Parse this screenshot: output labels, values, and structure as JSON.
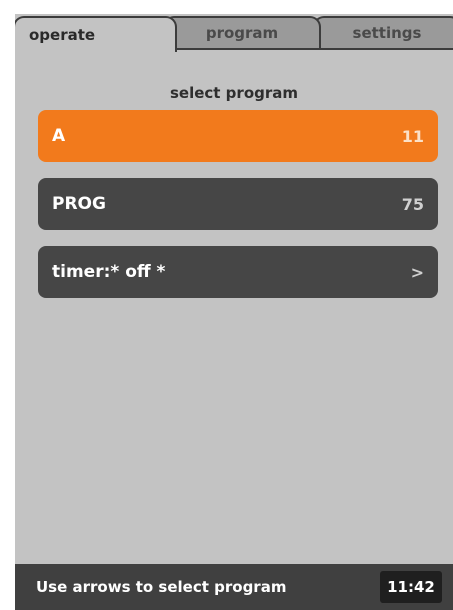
{
  "tabs": [
    {
      "label": "operate",
      "active": true
    },
    {
      "label": "program",
      "active": false
    },
    {
      "label": "settings",
      "active": false
    }
  ],
  "heading": "select program",
  "items": [
    {
      "label": "A",
      "value": "11",
      "selected": true
    },
    {
      "label": "PROG",
      "value": "75",
      "selected": false
    },
    {
      "label": "timer:* off *",
      "value": ">",
      "selected": false
    }
  ],
  "status": {
    "message": "Use arrows to select program",
    "time": "11:42"
  },
  "colors": {
    "background": "#c3c3c3",
    "accent": "#f27a1c",
    "row": "#464646",
    "statusbar": "#404040"
  }
}
